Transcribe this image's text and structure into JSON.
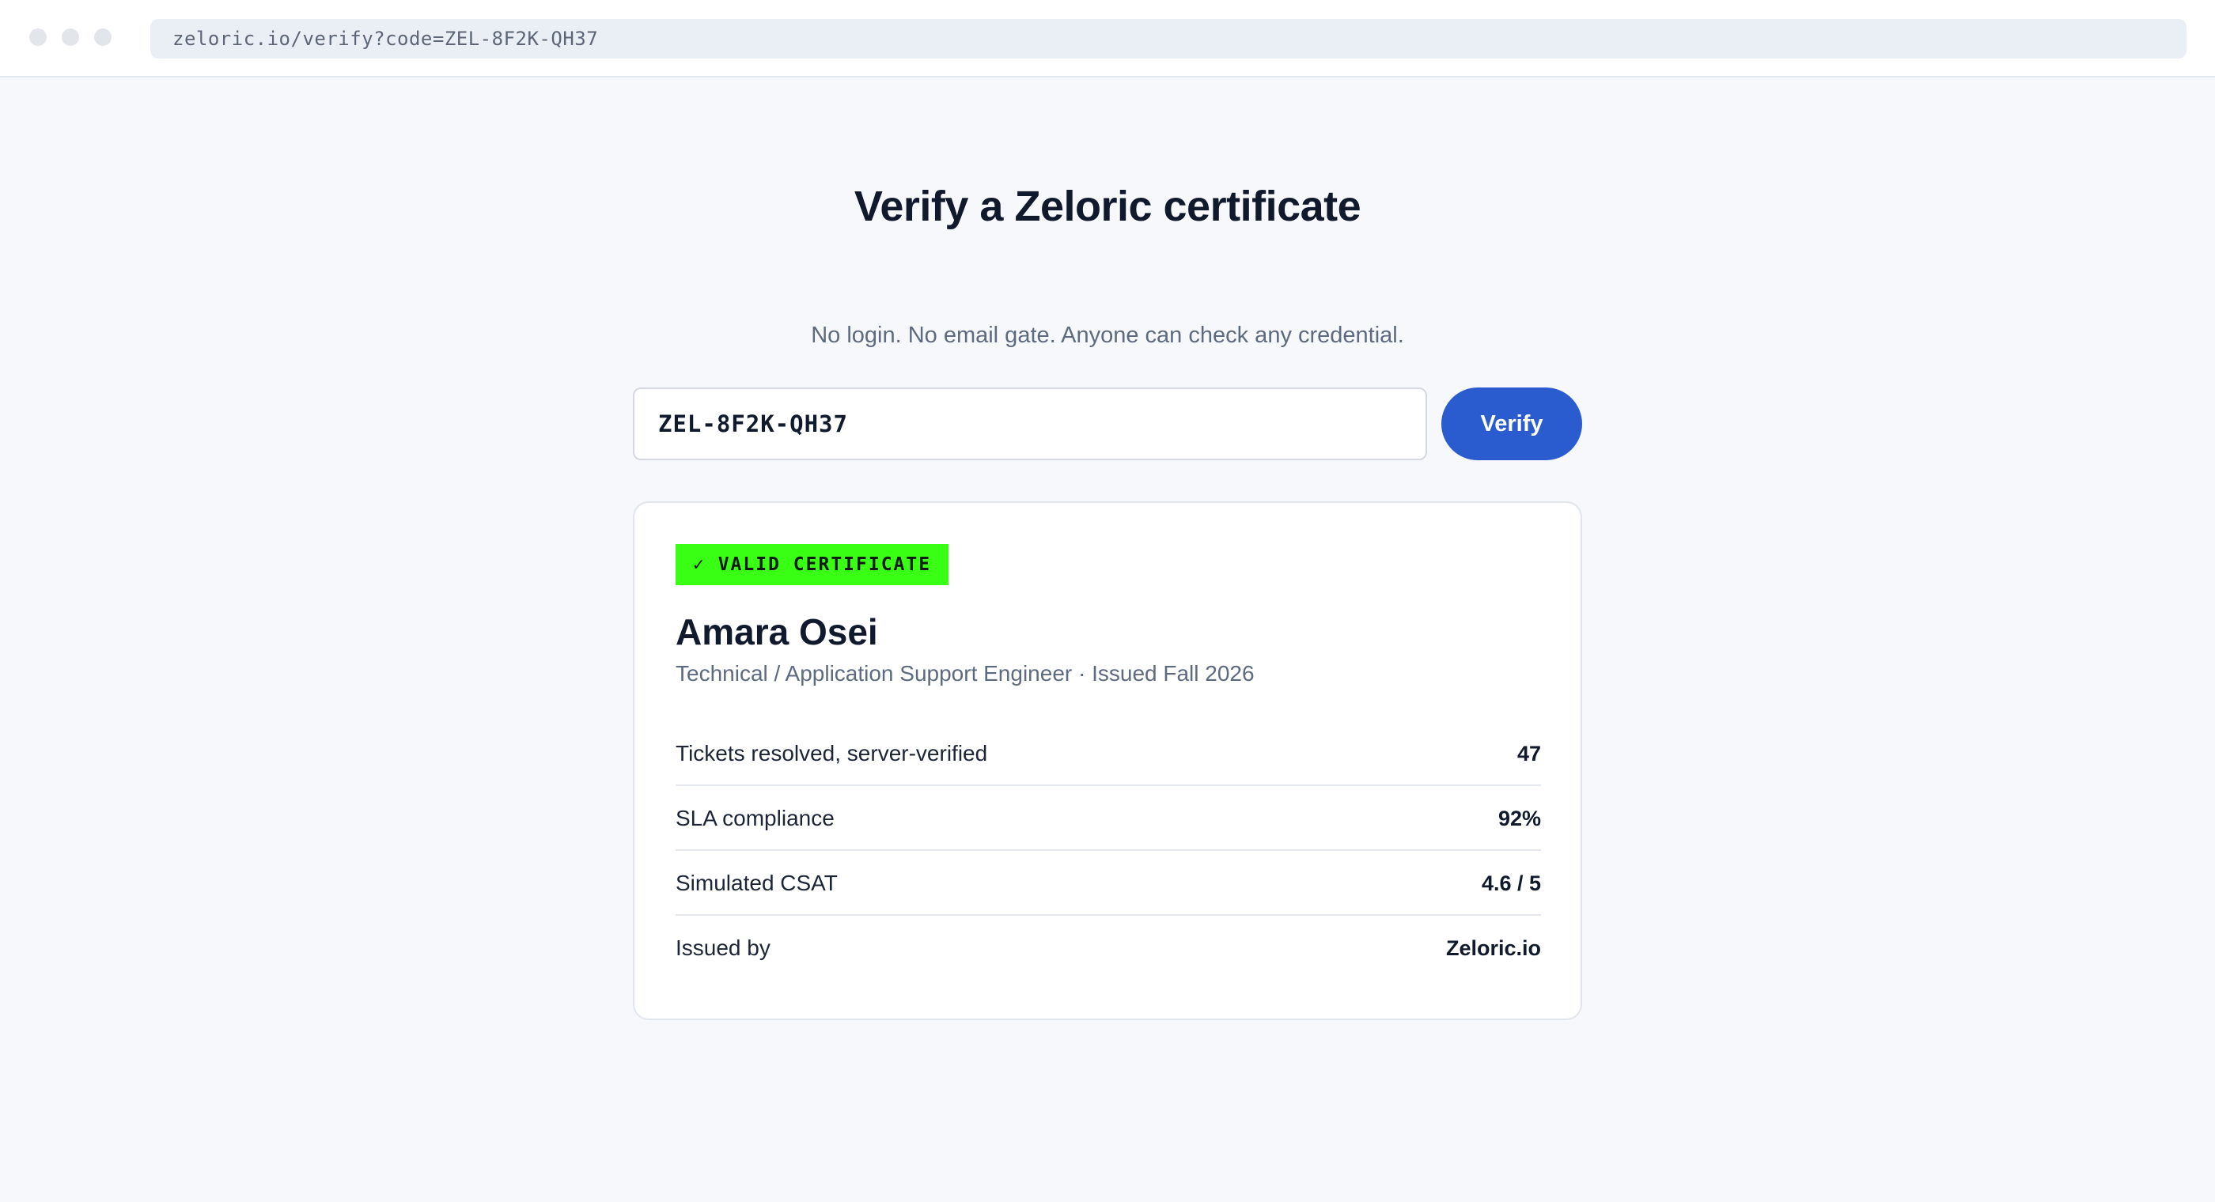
{
  "browser": {
    "url": "zeloric.io/verify?code=ZEL-8F2K-QH37"
  },
  "page": {
    "title": "Verify a Zeloric certificate",
    "subtitle": "No login. No email gate. Anyone can check any credential."
  },
  "search": {
    "value": "ZEL-8F2K-QH37",
    "button_label": "Verify"
  },
  "certificate": {
    "badge": "✓ VALID CERTIFICATE",
    "badge_color": "#39ff14",
    "holder_name": "Amara Osei",
    "holder_meta": "Technical / Application Support Engineer · Issued Fall 2026",
    "rows": [
      {
        "label": "Tickets resolved, server-verified",
        "value": "47"
      },
      {
        "label": "SLA compliance",
        "value": "92%"
      },
      {
        "label": "Simulated CSAT",
        "value": "4.6 / 5"
      },
      {
        "label": "Issued by",
        "value": "Zeloric.io"
      }
    ]
  },
  "colors": {
    "accent": "#2b5ccf",
    "valid": "#39ff14",
    "background": "#f6f8fb"
  }
}
